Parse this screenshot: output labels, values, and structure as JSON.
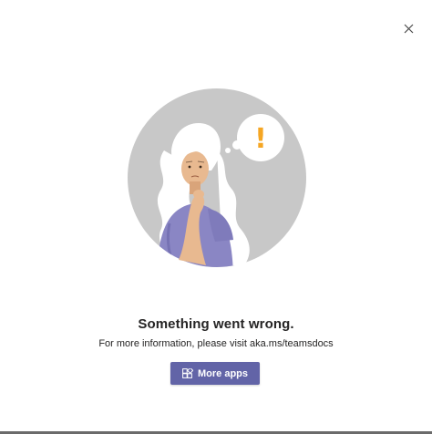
{
  "dialog": {
    "title": "Something went wrong.",
    "message": "For more information, please visit aka.ms/teamsdocs",
    "primary_button_label": "More apps",
    "primary_button_icon": "apps-icon",
    "close_icon": "close-icon"
  },
  "illustration": {
    "subject": "person-thinking-icon",
    "thought_symbol": "!"
  },
  "colors": {
    "accent": "#6264a7",
    "circle": "#c8c8c8",
    "warning": "#f5a623",
    "text": "#252424"
  }
}
